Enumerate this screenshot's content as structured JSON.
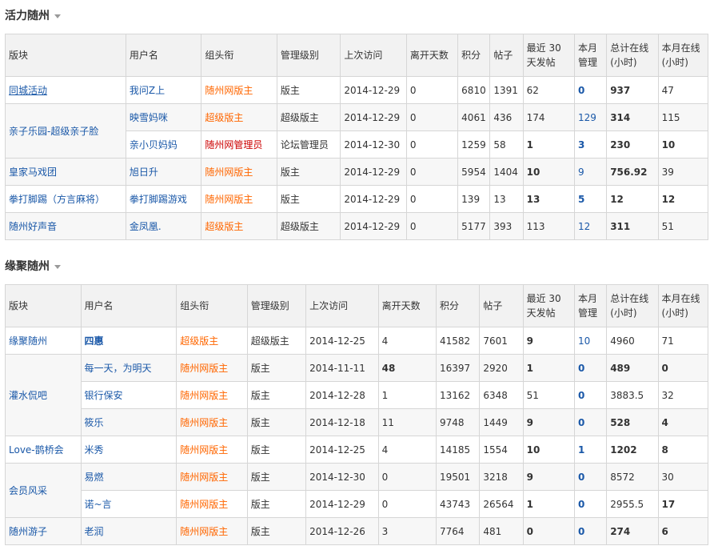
{
  "headers": [
    "版块",
    "用户名",
    "组头衔",
    "管理级别",
    "上次访问",
    "离开天数",
    "积分",
    "帖子",
    "最近 30 天发帖",
    "本月管理",
    "总计在线(小时)",
    "本月在线(小时)"
  ],
  "sections": [
    {
      "title": "活力随州",
      "rows": [
        {
          "forum": "同城活动",
          "user": "我问Z上",
          "title": "随州网版主",
          "title_color": "#ff6600",
          "level": "版主",
          "last": "2014-12-29",
          "days": "0",
          "days_bold": false,
          "points": "6810",
          "posts": "1391",
          "recent": "62",
          "recent_bold": false,
          "manage": "0",
          "manage_bold": true,
          "total": "937",
          "total_bold": true,
          "month": "47",
          "month_bold": false
        },
        {
          "forum": "亲子乐园-超级亲子脸",
          "user": "映雪妈咪",
          "title": "超级版主",
          "title_color": "#ff6600",
          "level": "超级版主",
          "last": "2014-12-29",
          "days": "0",
          "days_bold": false,
          "points": "4061",
          "posts": "436",
          "recent": "174",
          "recent_bold": false,
          "manage": "129",
          "manage_bold": false,
          "total": "314",
          "total_bold": true,
          "month": "115",
          "month_bold": false
        },
        {
          "forum": "",
          "user": "亲小贝妈妈",
          "title": "随州网管理员",
          "title_color": "#cc0000",
          "level": "论坛管理员",
          "last": "2014-12-30",
          "days": "0",
          "days_bold": false,
          "points": "1259",
          "posts": "58",
          "recent": "1",
          "recent_bold": true,
          "manage": "3",
          "manage_bold": true,
          "total": "230",
          "total_bold": true,
          "month": "10",
          "month_bold": true
        },
        {
          "forum": "皇家马戏团",
          "user": "旭日升",
          "title": "随州网版主",
          "title_color": "#ff6600",
          "level": "版主",
          "last": "2014-12-29",
          "days": "0",
          "days_bold": false,
          "points": "5954",
          "posts": "1404",
          "recent": "10",
          "recent_bold": true,
          "manage": "9",
          "manage_bold": false,
          "total": "756.92",
          "total_bold": true,
          "month": "39",
          "month_bold": false
        },
        {
          "forum": "拳打脚踢（方言麻将）",
          "user": "拳打脚踢游戏",
          "title": "随州网版主",
          "title_color": "#ff6600",
          "level": "版主",
          "last": "2014-12-29",
          "days": "0",
          "days_bold": false,
          "points": "139",
          "posts": "13",
          "recent": "13",
          "recent_bold": true,
          "manage": "5",
          "manage_bold": true,
          "total": "12",
          "total_bold": true,
          "month": "12",
          "month_bold": true
        },
        {
          "forum": "随州好声音",
          "user": "金凤凰.",
          "title": "超级版主",
          "title_color": "#ff6600",
          "level": "超级版主",
          "last": "2014-12-29",
          "days": "0",
          "days_bold": false,
          "points": "5177",
          "posts": "393",
          "recent": "113",
          "recent_bold": false,
          "manage": "12",
          "manage_bold": false,
          "total": "311",
          "total_bold": true,
          "month": "51",
          "month_bold": false
        }
      ]
    },
    {
      "title": "缘聚随州",
      "rows": [
        {
          "forum": "缘聚随州",
          "user": "四惠",
          "user_bold": true,
          "title": "超级版主",
          "title_color": "#ff6600",
          "level": "超级版主",
          "last": "2014-12-25",
          "days": "4",
          "days_bold": false,
          "points": "41582",
          "posts": "7601",
          "recent": "9",
          "recent_bold": true,
          "manage": "10",
          "manage_bold": false,
          "total": "4960",
          "total_bold": false,
          "month": "71",
          "month_bold": false
        },
        {
          "forum": "灌水侃吧",
          "user": "每一天，为明天",
          "title": "随州网版主",
          "title_color": "#ff6600",
          "level": "版主",
          "last": "2014-11-11",
          "days": "48",
          "days_bold": true,
          "points": "16397",
          "posts": "2920",
          "recent": "1",
          "recent_bold": true,
          "manage": "0",
          "manage_bold": true,
          "total": "489",
          "total_bold": true,
          "month": "0",
          "month_bold": true
        },
        {
          "forum": "",
          "user": "银行保安",
          "title": "随州网版主",
          "title_color": "#ff6600",
          "level": "版主",
          "last": "2014-12-28",
          "days": "1",
          "days_bold": false,
          "points": "13162",
          "posts": "6348",
          "recent": "51",
          "recent_bold": false,
          "manage": "0",
          "manage_bold": true,
          "total": "3883.5",
          "total_bold": false,
          "month": "32",
          "month_bold": false
        },
        {
          "forum": "",
          "user": "筱乐",
          "title": "随州网版主",
          "title_color": "#ff6600",
          "level": "版主",
          "last": "2014-12-18",
          "days": "11",
          "days_bold": false,
          "points": "9748",
          "posts": "1449",
          "recent": "9",
          "recent_bold": true,
          "manage": "0",
          "manage_bold": true,
          "total": "528",
          "total_bold": true,
          "month": "4",
          "month_bold": true
        },
        {
          "forum": "Love-鹊桥会",
          "user": "米秀",
          "title": "随州网版主",
          "title_color": "#ff6600",
          "level": "版主",
          "last": "2014-12-25",
          "days": "4",
          "days_bold": false,
          "points": "14185",
          "posts": "1554",
          "recent": "10",
          "recent_bold": true,
          "manage": "1",
          "manage_bold": true,
          "total": "1202",
          "total_bold": true,
          "month": "8",
          "month_bold": true
        },
        {
          "forum": "会员风采",
          "user": "易燃",
          "title": "随州网版主",
          "title_color": "#ff6600",
          "level": "版主",
          "last": "2014-12-30",
          "days": "0",
          "days_bold": false,
          "points": "19501",
          "posts": "3218",
          "recent": "9",
          "recent_bold": true,
          "manage": "0",
          "manage_bold": true,
          "total": "8572",
          "total_bold": false,
          "month": "30",
          "month_bold": false
        },
        {
          "forum": "",
          "user": "诺~言",
          "title": "随州网版主",
          "title_color": "#ff6600",
          "level": "版主",
          "last": "2014-12-29",
          "days": "0",
          "days_bold": false,
          "points": "43743",
          "posts": "26564",
          "recent": "1",
          "recent_bold": true,
          "manage": "0",
          "manage_bold": true,
          "total": "2955.5",
          "total_bold": false,
          "month": "17",
          "month_bold": true
        },
        {
          "forum": "随州游子",
          "user": "老润",
          "title": "随州网版主",
          "title_color": "#ff6600",
          "level": "版主",
          "last": "2014-12-26",
          "days": "3",
          "days_bold": false,
          "points": "7764",
          "posts": "481",
          "recent": "0",
          "recent_bold": true,
          "manage": "0",
          "manage_bold": true,
          "total": "274",
          "total_bold": true,
          "month": "6",
          "month_bold": true
        }
      ]
    }
  ]
}
